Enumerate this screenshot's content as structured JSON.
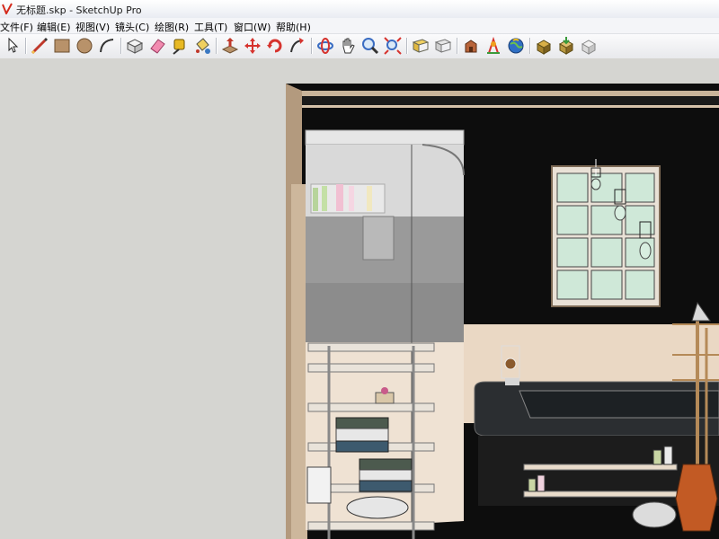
{
  "window": {
    "title": "无标题.skp - SketchUp Pro"
  },
  "menu": [
    {
      "label": "文件(F)"
    },
    {
      "label": "编辑(E)"
    },
    {
      "label": "视图(V)"
    },
    {
      "label": "镜头(C)"
    },
    {
      "label": "绘图(R)"
    },
    {
      "label": "工具(T)"
    },
    {
      "label": "窗口(W)"
    },
    {
      "label": "帮助(H)"
    }
  ],
  "toolbar": {
    "tools": [
      {
        "icon": "select-arrow-icon"
      },
      {
        "icon": "pencil-line-icon"
      },
      {
        "icon": "rectangle-icon"
      },
      {
        "icon": "circle-icon"
      },
      {
        "icon": "arc-icon"
      },
      {
        "icon": "make-component-icon"
      },
      {
        "icon": "eraser-icon"
      },
      {
        "icon": "tape-measure-icon"
      },
      {
        "icon": "paint-bucket-icon"
      },
      {
        "icon": "push-pull-icon"
      },
      {
        "icon": "move-icon"
      },
      {
        "icon": "rotate-icon"
      },
      {
        "icon": "follow-me-icon"
      },
      {
        "icon": "orbit-icon"
      },
      {
        "icon": "pan-hand-icon"
      },
      {
        "icon": "zoom-icon"
      },
      {
        "icon": "zoom-extents-icon"
      },
      {
        "icon": "previous-view-icon"
      },
      {
        "icon": "next-view-icon"
      },
      {
        "icon": "3d-warehouse-icon"
      },
      {
        "icon": "extension-warehouse-icon"
      },
      {
        "icon": "geo-location-icon"
      },
      {
        "icon": "share-model-icon"
      },
      {
        "icon": "get-models-icon"
      },
      {
        "icon": "send-to-layout-icon"
      }
    ]
  },
  "colors": {
    "viewport_background": "#d5d5d1",
    "wall_black": "#0a0a0a",
    "cream_wall": "#ead8c4",
    "window_glass": "#cfe8d8",
    "vase": "#c25a24"
  }
}
